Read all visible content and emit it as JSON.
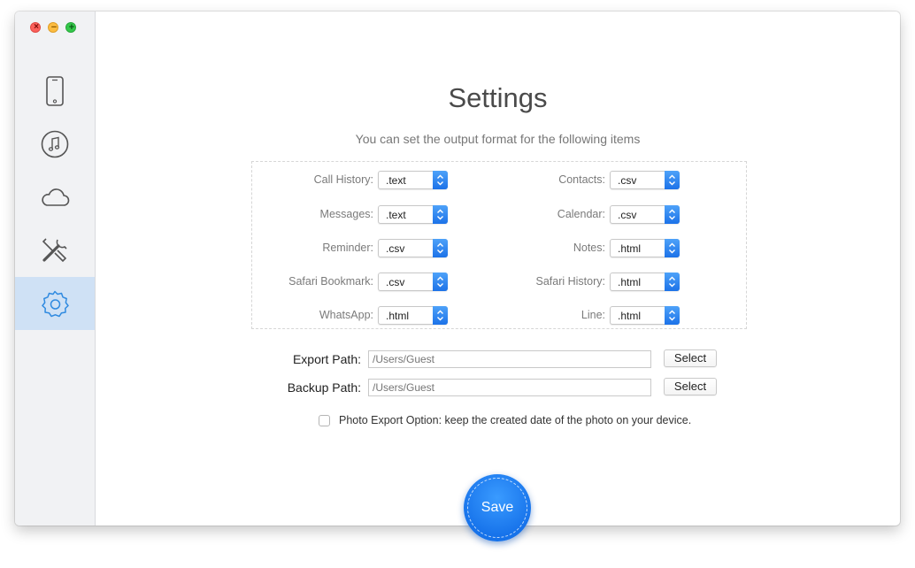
{
  "window": {
    "traffic_lights": {
      "close": "×",
      "minimize": "−",
      "maximize": "+"
    }
  },
  "sidebar": {
    "items": [
      {
        "icon": "phone-icon",
        "active": false
      },
      {
        "icon": "music-icon",
        "active": false
      },
      {
        "icon": "cloud-icon",
        "active": false
      },
      {
        "icon": "tools-icon",
        "active": false
      },
      {
        "icon": "gear-icon",
        "active": true
      }
    ]
  },
  "settings": {
    "title": "Settings",
    "subtitle": "You can set the output format for the following items",
    "formats": [
      {
        "label": "Call History:",
        "value": ".text"
      },
      {
        "label": "Contacts:",
        "value": ".csv"
      },
      {
        "label": "Messages:",
        "value": ".text"
      },
      {
        "label": "Calendar:",
        "value": ".csv"
      },
      {
        "label": "Reminder:",
        "value": ".csv"
      },
      {
        "label": "Notes:",
        "value": ".html"
      },
      {
        "label": "Safari Bookmark:",
        "value": ".csv"
      },
      {
        "label": "Safari History:",
        "value": ".html"
      },
      {
        "label": "WhatsApp:",
        "value": ".html"
      },
      {
        "label": "Line:",
        "value": ".html"
      }
    ],
    "export_path": {
      "label": "Export Path:",
      "placeholder": "/Users/Guest",
      "button": "Select"
    },
    "backup_path": {
      "label": "Backup Path:",
      "placeholder": "/Users/Guest",
      "button": "Select"
    },
    "photo_option": {
      "label": "Photo Export Option: keep the created date of the photo on your device.",
      "checked": false
    },
    "save_label": "Save"
  },
  "colors": {
    "accent": "#1c72e8",
    "sidebar_bg": "#f1f2f4",
    "active_bg": "#cfe1f5",
    "icon": "#555555",
    "active_icon": "#2f8ae0"
  }
}
